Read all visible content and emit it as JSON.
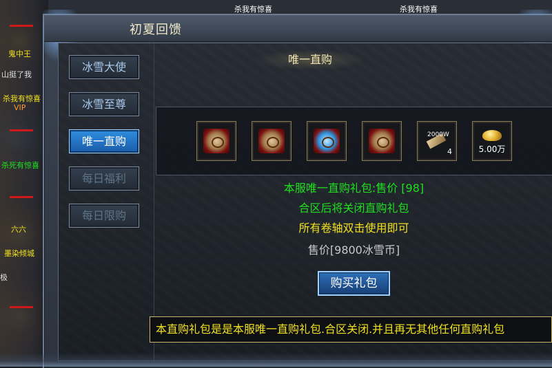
{
  "window": {
    "title": "初夏回馈",
    "heading": "唯一直购"
  },
  "nav": [
    {
      "label": "冰雪大使",
      "state": "normal"
    },
    {
      "label": "冰雪至尊",
      "state": "normal"
    },
    {
      "label": "唯一直购",
      "state": "active"
    },
    {
      "label": "每日福利",
      "state": "dim"
    },
    {
      "label": "每日限购",
      "state": "dim"
    }
  ],
  "items": [
    {
      "icon": "red-scroll-icon"
    },
    {
      "icon": "red-scroll-icon"
    },
    {
      "icon": "blue-scroll-icon"
    },
    {
      "icon": "red-scroll-icon"
    },
    {
      "icon": "stone-bar-icon",
      "top_label": "2000W",
      "qty": "4"
    },
    {
      "icon": "gold-ingot-icon",
      "label": "5.00万"
    }
  ],
  "info": {
    "line1": "本服唯一直购礼包:售价 [98]",
    "line2": "合区后将关闭直购礼包",
    "line3": "所有卷轴双击使用即可",
    "price": "售价[9800冰雪币]"
  },
  "buy_button": "购买礼包",
  "notice": "本直购礼包是是本服唯一直购礼包.合区关闭.并且再无其他任何直购礼包",
  "background": {
    "top_tags": [
      "杀我有惊喜",
      "杀我有惊喜"
    ],
    "side_tags": [
      "鬼中王",
      "山挺了我",
      "杀我有惊喜",
      "VIP",
      "杀死有惊喜",
      "六六",
      "墨染倾城",
      "极"
    ]
  },
  "colors": {
    "accent_green": "#1fe01f",
    "accent_yellow": "#f0e020",
    "active_tab": "#2f8ee0"
  }
}
